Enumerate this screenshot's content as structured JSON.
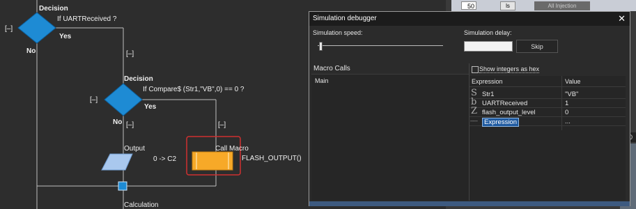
{
  "flowchart": {
    "decision1": {
      "title": "Decision",
      "condition": "If UARTReceived ?",
      "collapse": "[–]",
      "yes": "Yes",
      "no": "No"
    },
    "branch_marker_1": "[–]",
    "decision2": {
      "title": "Decision",
      "condition": "If Compare$ (Str1,\"VB\",0) == 0 ?",
      "collapse": "[–]",
      "yes": "Yes",
      "no": "No"
    },
    "branch_marker_no": "[–]",
    "branch_marker_yes": "[–]",
    "output": {
      "title": "Output",
      "text": "0 -> C2"
    },
    "call_macro": {
      "title": "Call Macro",
      "text": "FLASH_OUTPUT()"
    },
    "calculation": {
      "title": "Calculation"
    }
  },
  "background": {
    "spin_value": "50",
    "button_label": "ls",
    "tab_label": "All Injection"
  },
  "debugger": {
    "title": "Simulation debugger",
    "close": "✕",
    "speed_label": "Simulation speed:",
    "delay_label": "Simulation delay:",
    "skip_label": "Skip",
    "macro_calls_label": "Macro Calls",
    "macro_calls": [
      "Main"
    ],
    "show_hex_label": "Show integers as hex",
    "columns": {
      "expression": "Expression",
      "value": "Value"
    },
    "watch_rows": [
      {
        "icon": "S",
        "name": "Str1",
        "value": "\"VB\""
      },
      {
        "icon": "b",
        "name": "UARTReceived",
        "value": "1"
      },
      {
        "icon": "Z",
        "name": "flash_output_level",
        "value": "0"
      },
      {
        "icon": "----",
        "name": "Expression",
        "value": "..."
      }
    ]
  },
  "colors": {
    "decision": "#1e8bd4",
    "output": "#a9c8ee",
    "call_macro": "#f7a928",
    "highlight": "#d03030",
    "flow_line": "#bfbfbf"
  }
}
